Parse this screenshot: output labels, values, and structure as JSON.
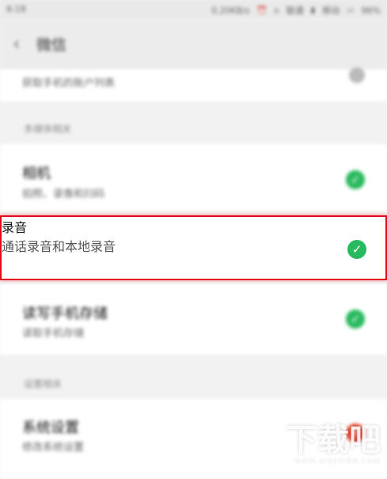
{
  "status_bar": {
    "time": "6:18",
    "speed": "0.20KB/s",
    "wifi": "WiFi",
    "carrier1": "联通",
    "carrier2": "移动",
    "battery": "96%",
    "alarm_icon": "alarm-icon",
    "wifi_icon": "wifi-icon",
    "battery_icon": "battery-icon"
  },
  "header": {
    "back_icon": "chevron-left-icon",
    "title": "微信"
  },
  "top_item": {
    "subtitle": "获取手机的账户列表",
    "status_icon": "toggle-icon"
  },
  "section_other": {
    "label": "多媒体相关"
  },
  "items": [
    {
      "title": "相机",
      "subtitle": "拍照、录像和扫码",
      "status_icon": "check-icon",
      "status_color": "#29b95e"
    },
    {
      "title": "录音",
      "subtitle": "通话录音和本地录音",
      "status_icon": "check-icon",
      "status_color": "#29b95e"
    },
    {
      "title": "读写手机存储",
      "subtitle": "读取手机存储",
      "status_icon": "check-icon",
      "status_color": "#29b95e"
    }
  ],
  "section_settings": {
    "label": "设置相关"
  },
  "settings_item": {
    "title": "系统设置",
    "subtitle": "修改系统设置",
    "status_icon": "warning-icon",
    "status_color": "#e34832"
  },
  "watermark": {
    "main": "下载吧",
    "url": "www.xiazaiba.com"
  }
}
